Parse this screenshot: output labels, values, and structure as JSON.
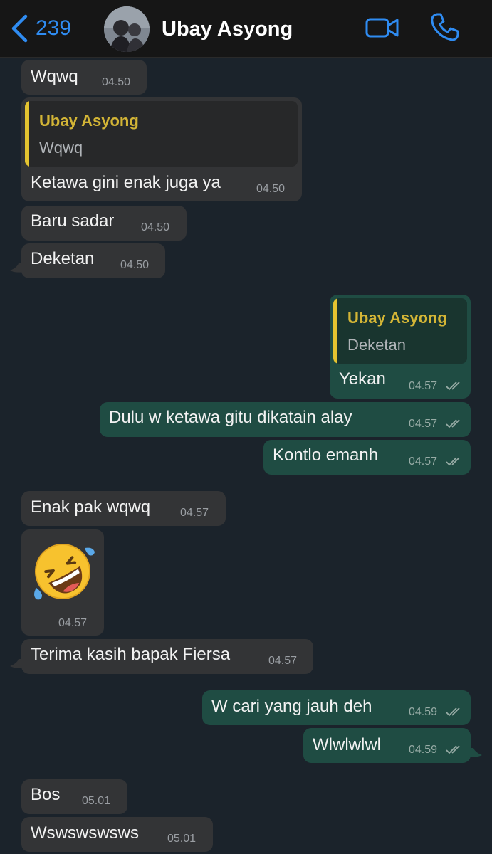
{
  "header": {
    "back_count": "239",
    "contact_name": "Ubay Asyong",
    "back_icon": "chevron-left-icon",
    "video_icon": "video-camera-icon",
    "call_icon": "phone-icon",
    "accent_color": "#2f8cf2"
  },
  "colors": {
    "background": "#1b232b",
    "incoming_bubble": "#333436",
    "outgoing_bubble": "#1f4c43",
    "quote_bar": "#e4c430"
  },
  "messages": [
    {
      "text": "Wqwq",
      "time": "04.50"
    },
    {
      "quote_name": "Ubay Asyong",
      "quote_text": "Wqwq",
      "text": "Ketawa gini enak juga ya",
      "time": "04.50"
    },
    {
      "text": "Baru sadar",
      "time": "04.50"
    },
    {
      "text": "Deketan",
      "time": "04.50"
    },
    {
      "quote_name": "Ubay Asyong",
      "quote_text": "Deketan",
      "text": "Yekan",
      "time": "04.57"
    },
    {
      "text": "Dulu w ketawa gitu dikatain alay",
      "time": "04.57"
    },
    {
      "text": "Kontlo emanh",
      "time": "04.57"
    },
    {
      "text": "Enak pak wqwq",
      "time": "04.57"
    },
    {
      "emoji": "rolling-on-the-floor-laughing",
      "time": "04.57"
    },
    {
      "text": "Terima kasih bapak Fiersa",
      "time": "04.57"
    },
    {
      "text": "W cari yang jauh deh",
      "time": "04.59"
    },
    {
      "text": "Wlwlwlwl",
      "time": "04.59"
    },
    {
      "text": "Bos",
      "time": "05.01"
    },
    {
      "text": "Wswswswsws",
      "time": "05.01"
    }
  ]
}
